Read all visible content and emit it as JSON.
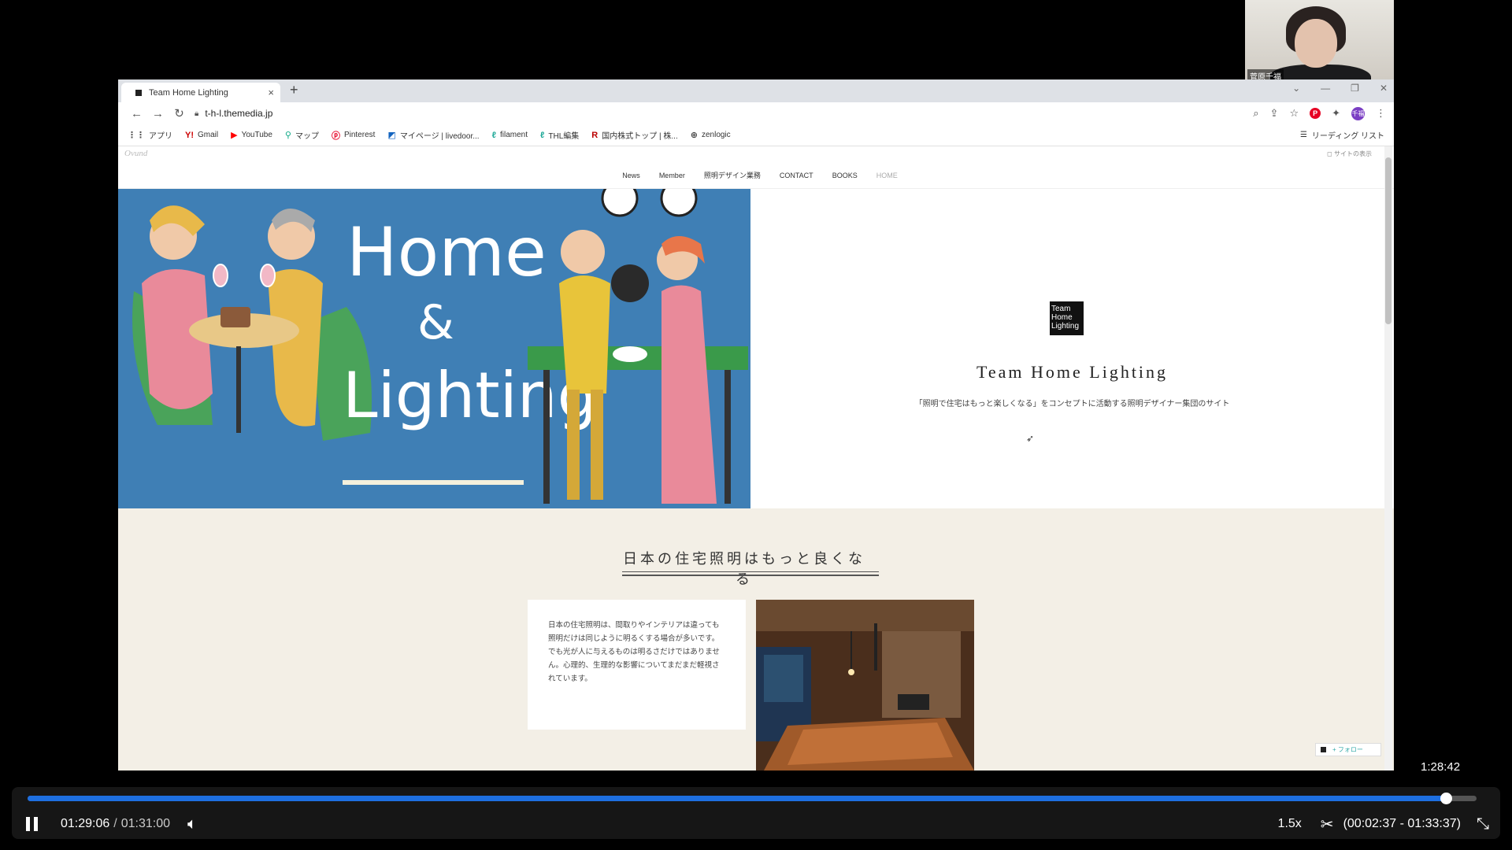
{
  "webcam": {
    "name": "菅原千福"
  },
  "browser": {
    "tab_title": "Team Home Lighting",
    "tab_close": "×",
    "new_tab": "+",
    "url": "t-h-l.themedia.jp",
    "bookmarks": [
      {
        "label": "アプリ",
        "icon": "apps-grid-icon"
      },
      {
        "label": "Gmail",
        "icon": "yahoo-mail-icon"
      },
      {
        "label": "YouTube",
        "icon": "youtube-icon"
      },
      {
        "label": "マップ",
        "icon": "maps-pin-icon"
      },
      {
        "label": "Pinterest",
        "icon": "pinterest-icon"
      },
      {
        "label": "マイページ | livedoor...",
        "icon": "livedoor-icon"
      },
      {
        "label": "filament",
        "icon": "filament-icon"
      },
      {
        "label": "THL編集",
        "icon": "thl-icon"
      },
      {
        "label": "国内株式トップ | 株...",
        "icon": "rakuten-icon"
      },
      {
        "label": "zenlogic",
        "icon": "globe-icon"
      }
    ],
    "reading_list": "リーディング リスト",
    "avatar_label": "千福"
  },
  "site": {
    "logo_small": "Ovund",
    "share_label": "サイトの表示",
    "nav": [
      "News",
      "Member",
      "照明デザイン業務",
      "CONTACT",
      "BOOKS",
      "HOME"
    ],
    "hero_art_text": [
      "Home",
      "&",
      "Lighting"
    ],
    "brand_box_lines": [
      "Team",
      "Home",
      "Lighting"
    ],
    "brand_title": "Team Home Lighting",
    "brand_subtitle": "「照明で住宅はもっと楽しくなる」をコンセプトに活動する照明デザイナー集団のサイト",
    "section_title": "日本の住宅照明はもっと良くなる",
    "section_body": "日本の住宅照明は、間取りやインテリアは違っても照明だけは同じように明るくする場合が多いです。でも光が人に与えるものは明るさだけではありません。心理的、生理的な影響についてまだまだ軽視されています。",
    "follow_label": "+ フォロー"
  },
  "video": {
    "hover_time": "1:28:42",
    "current_time": "01:29:06",
    "separator": "/",
    "duration": "01:31:00",
    "progress_fraction": 0.979,
    "speed": "1.5x",
    "clip_range": "(00:02:37 - 01:33:37)"
  },
  "colors": {
    "accent": "#1e6fe0",
    "hero_blue": "#3f7fb5",
    "section_bg": "#f3efe6"
  }
}
